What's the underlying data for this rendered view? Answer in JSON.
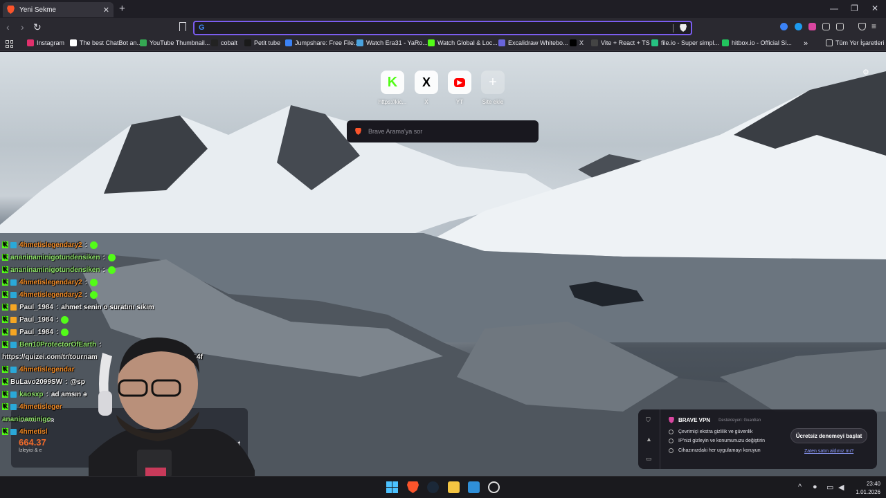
{
  "tab": {
    "title": "Yeni Sekme"
  },
  "urlbar": {
    "value": ""
  },
  "bookmarks": [
    {
      "label": "Instagram",
      "color": "#e1306c"
    },
    {
      "label": "The best ChatBot an...",
      "color": "#ffffff"
    },
    {
      "label": "YouTube Thumbnail...",
      "color": "#35a853"
    },
    {
      "label": "cobalt",
      "color": "#222222"
    },
    {
      "label": "Petit tube",
      "color": "#1a1a1a"
    },
    {
      "label": "Jumpshare: Free File...",
      "color": "#3b82f6"
    },
    {
      "label": "Watch Era31 - YaRo...",
      "color": "#4aa3df"
    },
    {
      "label": "Watch Global & Loc...",
      "color": "#53fc18"
    },
    {
      "label": "Excalidraw Whitebo...",
      "color": "#6965db"
    },
    {
      "label": "X",
      "color": "#000000"
    },
    {
      "label": "Vite + React + TS",
      "color": "#444444"
    },
    {
      "label": "file.io - Super simpl...",
      "color": "#26c281"
    },
    {
      "label": "hitbox.io - Official Si...",
      "color": "#22c55e"
    }
  ],
  "all_bookmarks": "Tüm Yer İşaretleri",
  "shortcuts": [
    {
      "label": "https://kic...",
      "glyph": "K",
      "color": "#53fc18"
    },
    {
      "label": "X",
      "glyph": "X",
      "color": "#000000"
    },
    {
      "label": "YT",
      "glyph": "▶",
      "color": "#ff0000"
    },
    {
      "label": "Site ekle",
      "glyph": "+",
      "color": "#ffffff"
    }
  ],
  "search": {
    "placeholder": "Brave Arama'ya sor"
  },
  "chat": [
    {
      "nick": "4hmetislegendary2",
      "nick_class": "nick-orange",
      "badges": "kb",
      "msg": "",
      "emote": true
    },
    {
      "nick": "ananinaminigotundensiken",
      "nick_class": "nick-green",
      "badges": "k",
      "msg": "",
      "emote": true
    },
    {
      "nick": "ananinaminigotundensiken",
      "nick_class": "nick-green",
      "badges": "k",
      "msg": "",
      "emote": true
    },
    {
      "nick": "4hmetislegendary2",
      "nick_class": "nick-orange",
      "badges": "kb",
      "msg": "",
      "emote": true
    },
    {
      "nick": "4hmetislegendary2",
      "nick_class": "nick-orange",
      "badges": "kb",
      "msg": "",
      "emote": true
    },
    {
      "nick": "Paul_1984",
      "nick_class": "nick-white",
      "badges": "kb",
      "msg": "ahmet senin o suratını sıkım",
      "emote": false
    },
    {
      "nick": "Paul_1984",
      "nick_class": "nick-white",
      "badges": "kb",
      "msg": "",
      "emote": true
    },
    {
      "nick": "Paul_1984",
      "nick_class": "nick-white",
      "badges": "kb",
      "msg": "",
      "emote": true
    },
    {
      "nick": "Ben10ProtectorOfEarth",
      "nick_class": "nick-green",
      "badges": "kb",
      "msg": "",
      "emote": false
    },
    {
      "nick": "https://quizei.com/tr/tournam",
      "nick_class": "nick-white",
      "badges": "",
      "msg": "e07f314f",
      "emote": false
    },
    {
      "nick": "4hmetislegendar",
      "nick_class": "nick-orange",
      "badges": "kb",
      "msg": "",
      "emote": false
    },
    {
      "nick": "BuLavo2099SW",
      "nick_class": "nick-white",
      "badges": "k",
      "msg": "@sp",
      "emote": false
    },
    {
      "nick": "kaosxp",
      "nick_class": "nick-green",
      "badges": "kb",
      "msg": "ad amsın ə",
      "emote": false
    },
    {
      "nick": "4hmetisleger",
      "nick_class": "nick-orange",
      "badges": "kb",
      "msg": "",
      "emote": false
    },
    {
      "nick": "ananinaminigo",
      "nick_class": "nick-green",
      "badges": "",
      "msg": "",
      "emote": false
    },
    {
      "nick": "4hmetisl",
      "nick_class": "nick-orange",
      "badges": "kb",
      "msg": "",
      "emote": false
    }
  ],
  "stats": {
    "label": "İSTATİSTİKLER",
    "value": "664.37",
    "sub": "İzleyici & e",
    "saat": "Saat"
  },
  "vpn": {
    "title": "BRAVE VPN",
    "by": "Destekleyen: Guardian",
    "features": [
      "Çevrimiçi ekstra gizlilik ve güvenlik",
      "IP'nizi gizleyin ve konumunuzu değiştirin",
      "Cihazınızdaki her uygulamayı koruyun"
    ],
    "cta": "Ücretsiz denemeyi başlat",
    "link": "Zaten satın aldınız mı?"
  },
  "clock": {
    "time": "23:40",
    "date": "1.01.2026"
  }
}
